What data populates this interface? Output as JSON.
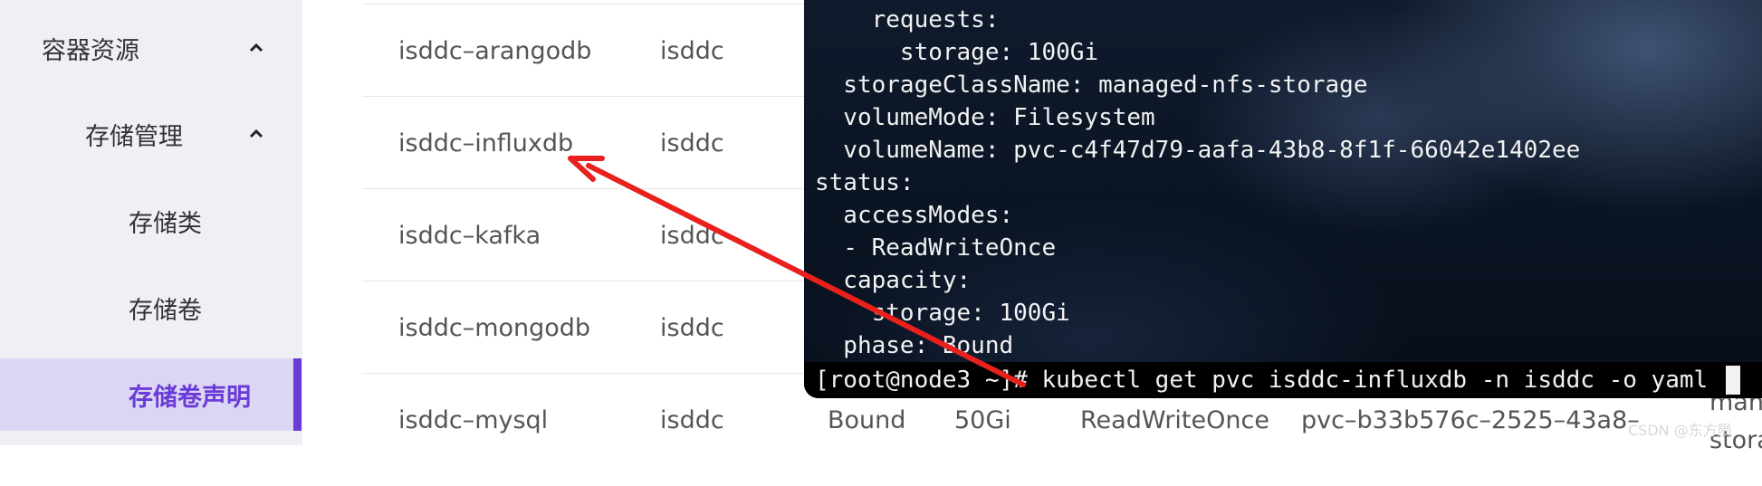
{
  "sidebar": {
    "items": [
      {
        "label": "容器资源",
        "expanded": true
      },
      {
        "label": "存储管理",
        "expanded": true
      },
      {
        "label": "存储类"
      },
      {
        "label": "存储卷"
      },
      {
        "label": "存储卷声明",
        "active": true
      }
    ],
    "accent_color": "#6a3bd8"
  },
  "table": {
    "rows": [
      {
        "name": "isddc–arangodb",
        "namespace": "isddc"
      },
      {
        "name": "isddc–influxdb",
        "namespace": "isddc"
      },
      {
        "name": "isddc–kafka",
        "namespace": "isddc"
      },
      {
        "name": "isddc–mongodb",
        "namespace": "isddc"
      },
      {
        "name": "isddc–mysql",
        "namespace": "isddc",
        "status": "Bound",
        "capacity": "50Gi",
        "access_mode": "ReadWriteOnce",
        "volume": "pvc–b33b576c–2525–43a8–",
        "extra": "man",
        "extra2": "stora"
      }
    ]
  },
  "terminal": {
    "lines": [
      "    requests:",
      "      storage: 100Gi",
      "  storageClassName: managed-nfs-storage",
      "  volumeMode: Filesystem",
      "  volumeName: pvc-c4f47d79-aafa-43b8-8f1f-66042e1402ee",
      "status:",
      "  accessModes:",
      "  - ReadWriteOnce",
      "  capacity:",
      "    storage: 100Gi",
      "  phase: Bound"
    ],
    "prompt": "[root@node3 ~]# kubectl get pvc isddc-influxdb -n isddc -o yaml"
  },
  "watermark": "CSDN @东方陨",
  "annotation": {
    "arrow_color": "#e8201e",
    "icon": "red-arrow-icon"
  }
}
